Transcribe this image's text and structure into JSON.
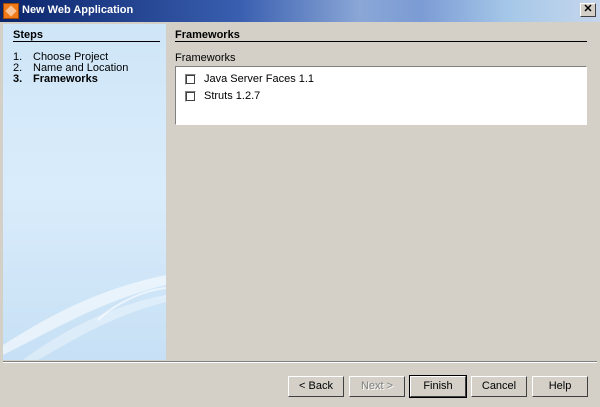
{
  "window": {
    "title": "New Web Application",
    "close_glyph": "✕"
  },
  "steps": {
    "header": "Steps",
    "items": [
      {
        "num": "1.",
        "label": "Choose Project",
        "active": false
      },
      {
        "num": "2.",
        "label": "Name and Location",
        "active": false
      },
      {
        "num": "3.",
        "label": "Frameworks",
        "active": true
      }
    ]
  },
  "panel": {
    "header": "Frameworks",
    "list_label": "Frameworks",
    "frameworks": [
      {
        "label": "Java Server Faces 1.1",
        "checked": false
      },
      {
        "label": "Struts 1.2.7",
        "checked": false
      }
    ]
  },
  "buttons": {
    "back": "< Back",
    "next": "Next >",
    "finish": "Finish",
    "cancel": "Cancel",
    "help": "Help"
  },
  "colors": {
    "titlebar_start": "#0a246a",
    "steps_bg": "#d9ecfb",
    "dialog_bg": "#d4d0c8",
    "app_icon": "#f07a1a"
  },
  "icons": {
    "app": "netbeans-app-icon",
    "close": "close-icon"
  }
}
